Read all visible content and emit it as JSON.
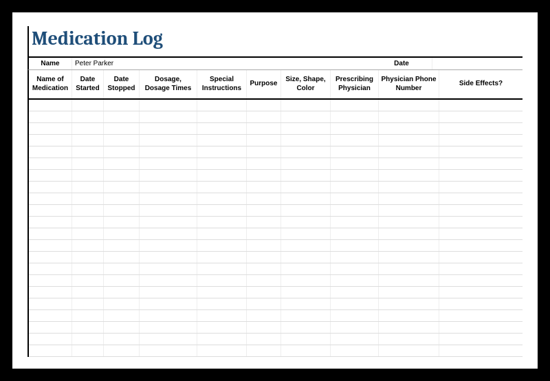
{
  "title": "Medication Log",
  "info": {
    "name_label": "Name",
    "name_value": "Peter Parker",
    "date_label": "Date",
    "date_value": ""
  },
  "columns": [
    "Name of Medication",
    "Date Started",
    "Date Stopped",
    "Dosage, Dosage Times",
    "Special Instructions",
    "Purpose",
    "Size, Shape, Color",
    "Prescribing Physician",
    "Physician Phone Number",
    "Side Effects?"
  ],
  "row_count": 22
}
